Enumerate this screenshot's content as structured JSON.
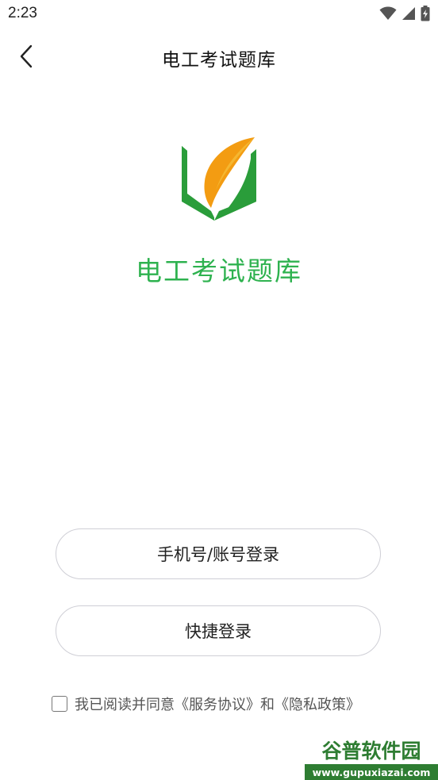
{
  "status_bar": {
    "time": "2:23",
    "icons": [
      "wifi-icon",
      "signal-icon",
      "battery-charging-icon"
    ]
  },
  "header": {
    "back_icon": "chevron-left-icon",
    "title": "电工考试题库"
  },
  "app": {
    "name": "电工考试题库",
    "brand_color": "#2eb24f",
    "logo_colors": [
      "#2a9d3a",
      "#f39c12"
    ]
  },
  "buttons": {
    "phone_login": "手机号/账号登录",
    "quick_login": "快捷登录"
  },
  "agreement": {
    "prefix": "我已阅读并同意",
    "terms": "《服务协议》",
    "conjunction": "和",
    "privacy": "《隐私政策》",
    "checked": false
  },
  "watermark": {
    "title": "谷普软件园",
    "url": "www.gupuxiazai.com"
  }
}
